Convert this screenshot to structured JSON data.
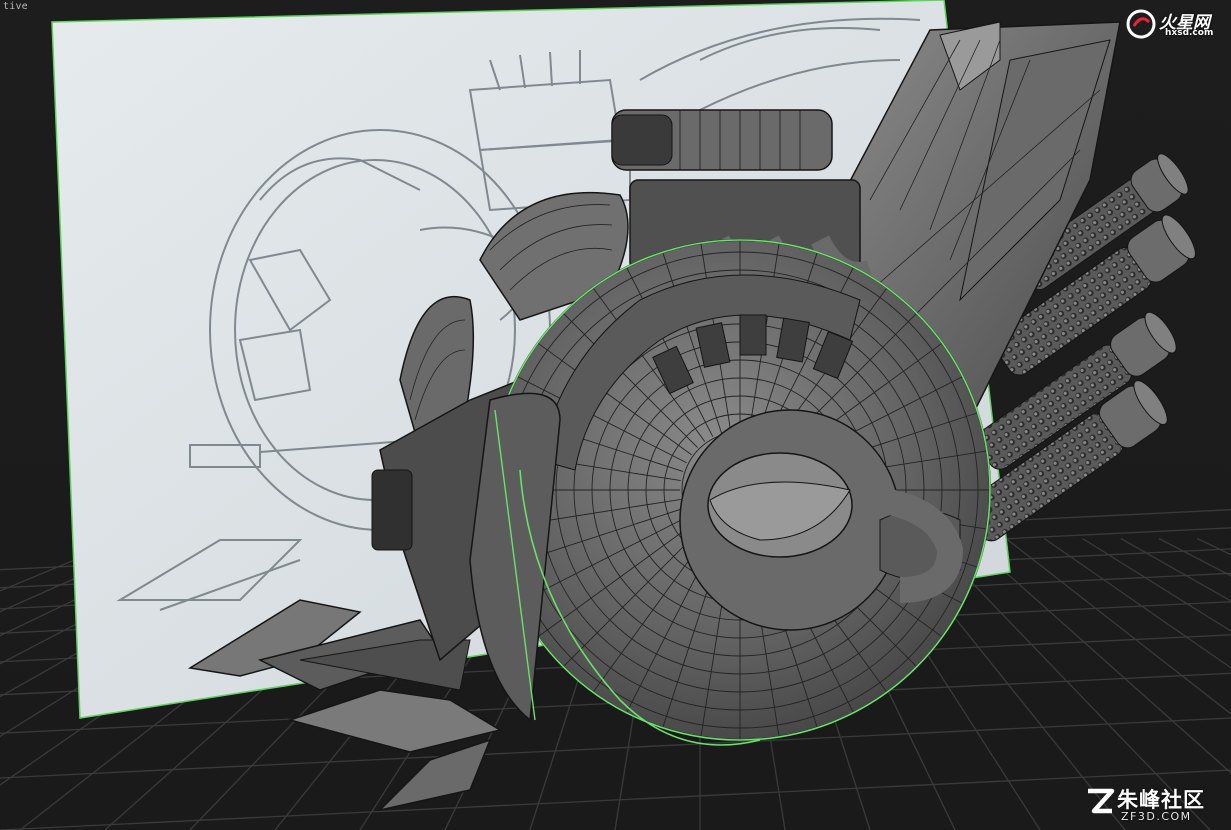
{
  "viewport": {
    "label": "tive"
  },
  "watermarks": {
    "top_right": {
      "name": "火星网",
      "domain": "hxsd.com"
    },
    "bottom_right": {
      "name": "朱峰社区",
      "domain": "ZF3D.COM"
    }
  },
  "colors": {
    "background": "#1c1c1c",
    "grid_line": "#3a3a3a",
    "reference_plane": "#d9dfe2",
    "selection_wire": "#6be06b",
    "model_shade": "#5e5e5e",
    "wire": "#1a1a1a"
  }
}
